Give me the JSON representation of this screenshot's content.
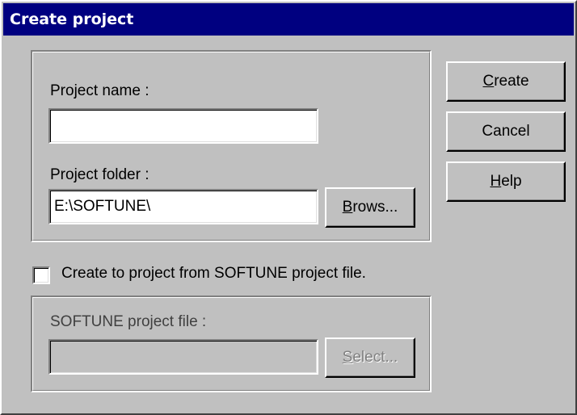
{
  "dialog": {
    "title": "Create project"
  },
  "project_group": {
    "name_label": "Project name :",
    "name_value": "",
    "folder_label": "Project folder :",
    "folder_value": "E:\\SOFTUNE\\",
    "browse_button": {
      "accel": "B",
      "rest": "rows..."
    }
  },
  "buttons": {
    "create": {
      "accel": "C",
      "rest": "reate"
    },
    "cancel": "Cancel",
    "help": {
      "accel": "H",
      "rest": "elp"
    }
  },
  "import_option": {
    "checkbox_label": "Create to project from SOFTUNE project file.",
    "checked": false,
    "file_label": "SOFTUNE project file :",
    "file_value": "",
    "select_button": {
      "accel": "S",
      "rest": "elect..."
    }
  }
}
